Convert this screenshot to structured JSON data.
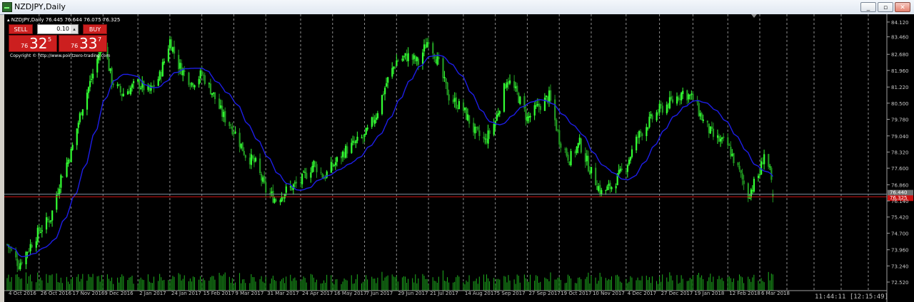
{
  "window": {
    "title": "NZDJPY,Daily",
    "minimize_label": "_",
    "restore_label": "▫",
    "close_label": "✕"
  },
  "chart_header": {
    "text": "NZDJPY,Daily  76.445 76.644 76.075 76.325"
  },
  "trade_panel": {
    "sell_label": "SELL",
    "buy_label": "BUY",
    "lot_value": "0.10",
    "sell_price": {
      "prefix": "76",
      "big": "32",
      "sup": "5"
    },
    "buy_price": {
      "prefix": "76",
      "big": "33",
      "sup": "7"
    },
    "copyright": "Copyright © http://www.pointzero-trading.com"
  },
  "clock": "11:44:11 [12:15:49]",
  "colors": {
    "background": "#000000",
    "bull_candle": "#33ff33",
    "bear_candle": "#229922",
    "moving_average": "#1e1ee6",
    "grid": "#bfbfbf",
    "volume": "#1fb11f",
    "bid_line": "#cc1111",
    "ask_line": "#8090a0",
    "price_label_bid": "#cc1111",
    "price_label_ask": "#707070"
  },
  "chart_data": {
    "type": "candlestick",
    "title": "NZDJPY,Daily",
    "symbol": "NZDJPY",
    "timeframe": "Daily",
    "ohlc_last": {
      "open": 76.445,
      "high": 76.644,
      "low": 76.075,
      "close": 76.325
    },
    "ylim": [
      72.52,
      84.34
    ],
    "y_ticks": [
      "84.120",
      "83.460",
      "82.680",
      "81.960",
      "81.220",
      "80.500",
      "79.780",
      "79.040",
      "78.320",
      "77.600",
      "76.860",
      "76.140",
      "75.420",
      "74.700",
      "73.960",
      "73.240",
      "72.520"
    ],
    "x_ticks": [
      "4 Oct 2016",
      "26 Oct 2016",
      "17 Nov 2016",
      "9 Dec 2016",
      "2 Jan 2017",
      "24 Jan 2017",
      "15 Feb 2017",
      "9 Mar 2017",
      "31 Mar 2017",
      "24 Apr 2017",
      "16 May 2017",
      "7 Jun 2017",
      "29 Jun 2017",
      "21 Jul 2017",
      "14 Aug 2017",
      "5 Sep 2017",
      "27 Sep 2017",
      "19 Oct 2017",
      "10 Nov 2017",
      "4 Dec 2017",
      "27 Dec 2017",
      "19 Jan 2018",
      "12 Feb 2018",
      "6 Mar 2018"
    ],
    "anchors": [
      {
        "date": "4 Oct 2016",
        "close": 74.2
      },
      {
        "date": "12 Oct 2016",
        "close": 73.3
      },
      {
        "date": "26 Oct 2016",
        "close": 74.8
      },
      {
        "date": "3 Nov 2016",
        "close": 75.4
      },
      {
        "date": "10 Nov 2016",
        "close": 77.2
      },
      {
        "date": "17 Nov 2016",
        "close": 78.3
      },
      {
        "date": "24 Nov 2016",
        "close": 80.2
      },
      {
        "date": "1 Dec 2016",
        "close": 81.6
      },
      {
        "date": "9 Dec 2016",
        "close": 83.3
      },
      {
        "date": "15 Dec 2016",
        "close": 81.5
      },
      {
        "date": "22 Dec 2016",
        "close": 80.9
      },
      {
        "date": "2 Jan 2017",
        "close": 81.4
      },
      {
        "date": "10 Jan 2017",
        "close": 81.0
      },
      {
        "date": "17 Jan 2017",
        "close": 81.7
      },
      {
        "date": "24 Jan 2017",
        "close": 83.3
      },
      {
        "date": "30 Jan 2017",
        "close": 82.2
      },
      {
        "date": "8 Feb 2017",
        "close": 81.4
      },
      {
        "date": "15 Feb 2017",
        "close": 81.8
      },
      {
        "date": "22 Feb 2017",
        "close": 81.0
      },
      {
        "date": "1 Mar 2017",
        "close": 80.0
      },
      {
        "date": "9 Mar 2017",
        "close": 79.3
      },
      {
        "date": "17 Mar 2017",
        "close": 78.2
      },
      {
        "date": "24 Mar 2017",
        "close": 77.8
      },
      {
        "date": "31 Mar 2017",
        "close": 76.6
      },
      {
        "date": "7 Apr 2017",
        "close": 76.2
      },
      {
        "date": "14 Apr 2017",
        "close": 76.6
      },
      {
        "date": "24 Apr 2017",
        "close": 77.0
      },
      {
        "date": "3 May 2017",
        "close": 77.8
      },
      {
        "date": "10 May 2017",
        "close": 77.2
      },
      {
        "date": "16 May 2017",
        "close": 77.7
      },
      {
        "date": "25 May 2017",
        "close": 78.4
      },
      {
        "date": "7 Jun 2017",
        "close": 79.0
      },
      {
        "date": "15 Jun 2017",
        "close": 80.0
      },
      {
        "date": "22 Jun 2017",
        "close": 81.4
      },
      {
        "date": "29 Jun 2017",
        "close": 82.4
      },
      {
        "date": "7 Jul 2017",
        "close": 82.6
      },
      {
        "date": "14 Jul 2017",
        "close": 82.3
      },
      {
        "date": "21 Jul 2017",
        "close": 83.4
      },
      {
        "date": "28 Jul 2017",
        "close": 82.2
      },
      {
        "date": "4 Aug 2017",
        "close": 80.8
      },
      {
        "date": "14 Aug 2017",
        "close": 80.2
      },
      {
        "date": "22 Aug 2017",
        "close": 79.2
      },
      {
        "date": "29 Aug 2017",
        "close": 78.8
      },
      {
        "date": "5 Sep 2017",
        "close": 79.7
      },
      {
        "date": "13 Sep 2017",
        "close": 81.6
      },
      {
        "date": "20 Sep 2017",
        "close": 80.9
      },
      {
        "date": "27 Sep 2017",
        "close": 79.8
      },
      {
        "date": "4 Oct 2017",
        "close": 80.3
      },
      {
        "date": "12 Oct 2017",
        "close": 80.8
      },
      {
        "date": "19 Oct 2017",
        "close": 78.9
      },
      {
        "date": "26 Oct 2017",
        "close": 78.0
      },
      {
        "date": "2 Nov 2017",
        "close": 78.7
      },
      {
        "date": "10 Nov 2017",
        "close": 77.4
      },
      {
        "date": "17 Nov 2017",
        "close": 76.5
      },
      {
        "date": "24 Nov 2017",
        "close": 76.8
      },
      {
        "date": "4 Dec 2017",
        "close": 77.7
      },
      {
        "date": "12 Dec 2017",
        "close": 79.0
      },
      {
        "date": "19 Dec 2017",
        "close": 79.6
      },
      {
        "date": "27 Dec 2017",
        "close": 80.2
      },
      {
        "date": "5 Jan 2018",
        "close": 80.6
      },
      {
        "date": "12 Jan 2018",
        "close": 81.0
      },
      {
        "date": "19 Jan 2018",
        "close": 80.7
      },
      {
        "date": "26 Jan 2018",
        "close": 79.7
      },
      {
        "date": "2 Feb 2018",
        "close": 79.0
      },
      {
        "date": "12 Feb 2018",
        "close": 78.6
      },
      {
        "date": "20 Feb 2018",
        "close": 77.4
      },
      {
        "date": "26 Feb 2018",
        "close": 76.4
      },
      {
        "date": "6 Mar 2018",
        "close": 77.4
      },
      {
        "date": "9 Mar 2018",
        "close": 78.3
      },
      {
        "date": "13 Mar 2018",
        "close": 77.4
      },
      {
        "date": "15 Mar 2018",
        "close": 76.33
      }
    ],
    "moving_average": {
      "name": "MA",
      "color": "#1e1ee6"
    },
    "bid_line": {
      "value": 76.325,
      "label": "76.325"
    },
    "ask_line": {
      "value": 76.44,
      "label": "76.440"
    },
    "grid": true,
    "volume_panel": true
  }
}
